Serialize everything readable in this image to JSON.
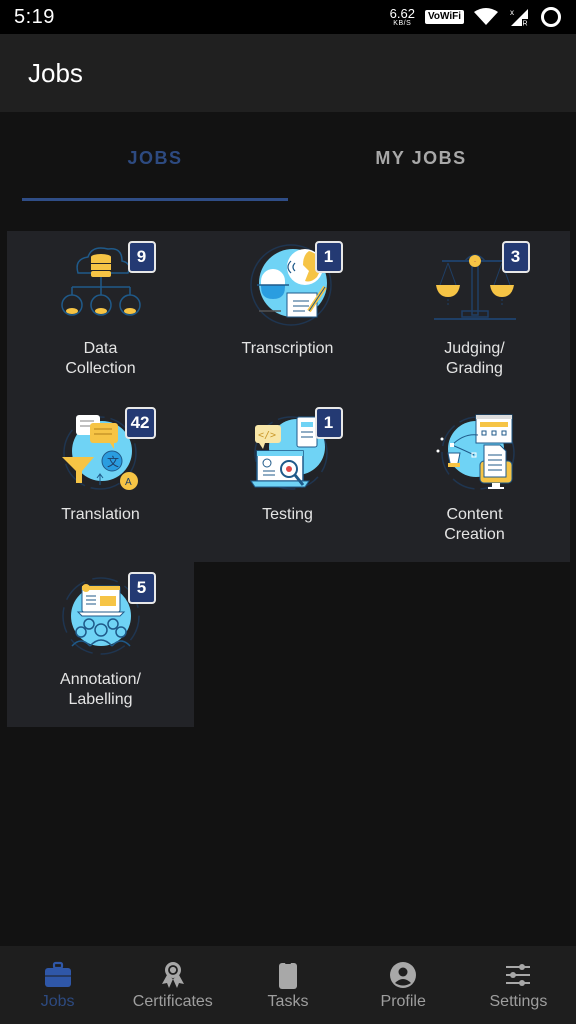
{
  "status_bar": {
    "time": "5:19",
    "net_speed_value": "6.62",
    "net_speed_unit": "KB/S",
    "vowifi_label": "VoWiFi",
    "icons": [
      "wifi-icon",
      "signal-icon",
      "battery-ring-icon"
    ]
  },
  "app_bar": {
    "title": "Jobs"
  },
  "tabs": [
    {
      "label": "JOBS",
      "active": true
    },
    {
      "label": "MY JOBS",
      "active": false
    }
  ],
  "categories": [
    {
      "label": "Data\nCollection",
      "count": "9",
      "icon": "data-collection-icon"
    },
    {
      "label": "Transcription",
      "count": "1",
      "icon": "transcription-icon"
    },
    {
      "label": "Judging/\nGrading",
      "count": "3",
      "icon": "scale-icon"
    },
    {
      "label": "Translation",
      "count": "42",
      "icon": "translation-icon"
    },
    {
      "label": "Testing",
      "count": "1",
      "icon": "testing-icon"
    },
    {
      "label": "Content\nCreation",
      "count": null,
      "icon": "content-creation-icon"
    },
    {
      "label": "Annotation/\nLabelling",
      "count": "5",
      "icon": "annotation-icon"
    }
  ],
  "bottom_nav": [
    {
      "label": "Jobs",
      "icon": "briefcase-icon",
      "active": true
    },
    {
      "label": "Certificates",
      "icon": "award-icon",
      "active": false
    },
    {
      "label": "Tasks",
      "icon": "clipboard-icon",
      "active": false
    },
    {
      "label": "Profile",
      "icon": "account-circle-icon",
      "active": false
    },
    {
      "label": "Settings",
      "icon": "sliders-icon",
      "active": false
    }
  ],
  "colors": {
    "accent": "#2f4d86",
    "badge_bg": "#243a73",
    "card_bg": "#222327",
    "page_bg": "#121212",
    "app_bar_bg": "#202020",
    "icon_yellow": "#f6c445",
    "icon_cyan": "#6fd3f5"
  }
}
